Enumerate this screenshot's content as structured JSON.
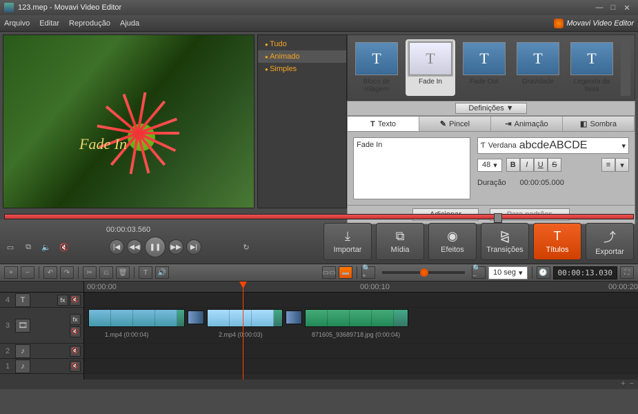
{
  "window": {
    "title": "123.mep - Movavi Video Editor",
    "brand": "Movavi Video Editor"
  },
  "menu": {
    "file": "Arquivo",
    "edit": "Editar",
    "play": "Reprodução",
    "help": "Ajuda"
  },
  "categories": {
    "all": "Tudo",
    "animated": "Animado",
    "simple": "Simples",
    "selected": "Animado"
  },
  "preview": {
    "overlay": "Fade In",
    "timecode": "00:00:03.560"
  },
  "title_presets": [
    {
      "name": "Bloco de rolagem"
    },
    {
      "name": "Fade In"
    },
    {
      "name": "Fade Out"
    },
    {
      "name": "Gravidade"
    },
    {
      "name": "Legenda da faixa"
    }
  ],
  "title_selected": "Fade In",
  "definitions_label": "Definições",
  "property_tabs": {
    "text": "Texto",
    "brush": "Pincel",
    "anim": "Animação",
    "shadow": "Sombra",
    "selected": "Texto"
  },
  "text_props": {
    "text_value": "Fade In",
    "font_name": "Verdana",
    "font_sample": "abcdeABCDE",
    "font_size": "48",
    "duration_label": "Duração",
    "duration_value": "00:00:05.000"
  },
  "buttons": {
    "add": "Adicionar",
    "defaults": "Para padrões"
  },
  "main_tabs": {
    "import": "Importar",
    "media": "Mídia",
    "effects": "Efeitos",
    "transitions": "Transições",
    "titles": "Títulos",
    "export": "Exportar",
    "active": "Títulos"
  },
  "timeline": {
    "zoom_label": "10 seg",
    "total_time": "00:00:13.030",
    "ruler": [
      "00:00:00",
      "00:00:10",
      "00:00:20"
    ],
    "tracks": [
      {
        "num": "4",
        "type": "T"
      },
      {
        "num": "3",
        "type": "film"
      },
      {
        "num": "2",
        "type": "audio"
      },
      {
        "num": "1",
        "type": "audio"
      }
    ],
    "clips": [
      {
        "label": "1.mp4 (0:00:04)"
      },
      {
        "label": "2.mp4 (0:00:03)"
      },
      {
        "label": "871605_93689718.jpg (0:00:04)"
      }
    ]
  }
}
